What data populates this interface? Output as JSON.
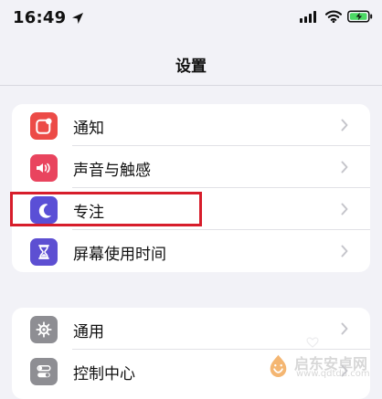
{
  "status_bar": {
    "time": "16:49",
    "icons": [
      "location-icon",
      "signal-icon",
      "wifi-icon",
      "battery-icon"
    ]
  },
  "header": {
    "title": "设置"
  },
  "groups": [
    {
      "items": [
        {
          "label": "通知",
          "icon": "bell-icon",
          "color": "#ec4b47"
        },
        {
          "label": "声音与触感",
          "icon": "speaker-icon",
          "color": "#e9445e"
        },
        {
          "label": "专注",
          "icon": "moon-icon",
          "color": "#5a4fd6"
        },
        {
          "label": "屏幕使用时间",
          "icon": "hourglass-icon",
          "color": "#5d4fd2"
        }
      ]
    },
    {
      "items": [
        {
          "label": "通用",
          "icon": "gear-icon",
          "color": "#8e8e93"
        },
        {
          "label": "控制中心",
          "icon": "toggles-icon",
          "color": "#8e8e93"
        }
      ]
    }
  ],
  "watermark": {
    "title": "启东安卓网",
    "url": "www.qdtdu.com"
  },
  "highlight": {
    "color": "#d71d2b"
  }
}
